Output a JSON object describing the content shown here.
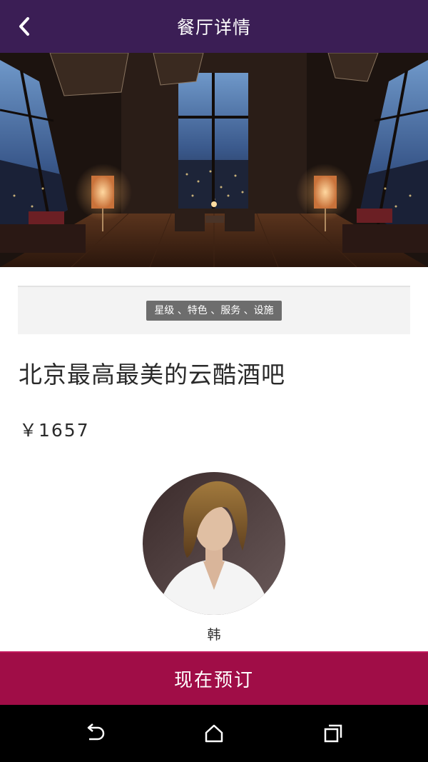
{
  "header": {
    "title": "餐厅详情"
  },
  "tags": {
    "label": "星级 、特色 、服务 、设施"
  },
  "restaurant": {
    "title": "北京最高最美的云酷酒吧",
    "price": "￥1657"
  },
  "host": {
    "name": "韩"
  },
  "actions": {
    "book_label": "现在预订"
  },
  "colors": {
    "header_bg": "#3b1e55",
    "book_button_bg": "#a00d47",
    "tag_chip_bg": "#6d6d6d"
  },
  "icons": {
    "back": "chevron-left-icon",
    "nav_back": "back-arrow-icon",
    "nav_home": "home-icon",
    "nav_recents": "recents-icon"
  }
}
